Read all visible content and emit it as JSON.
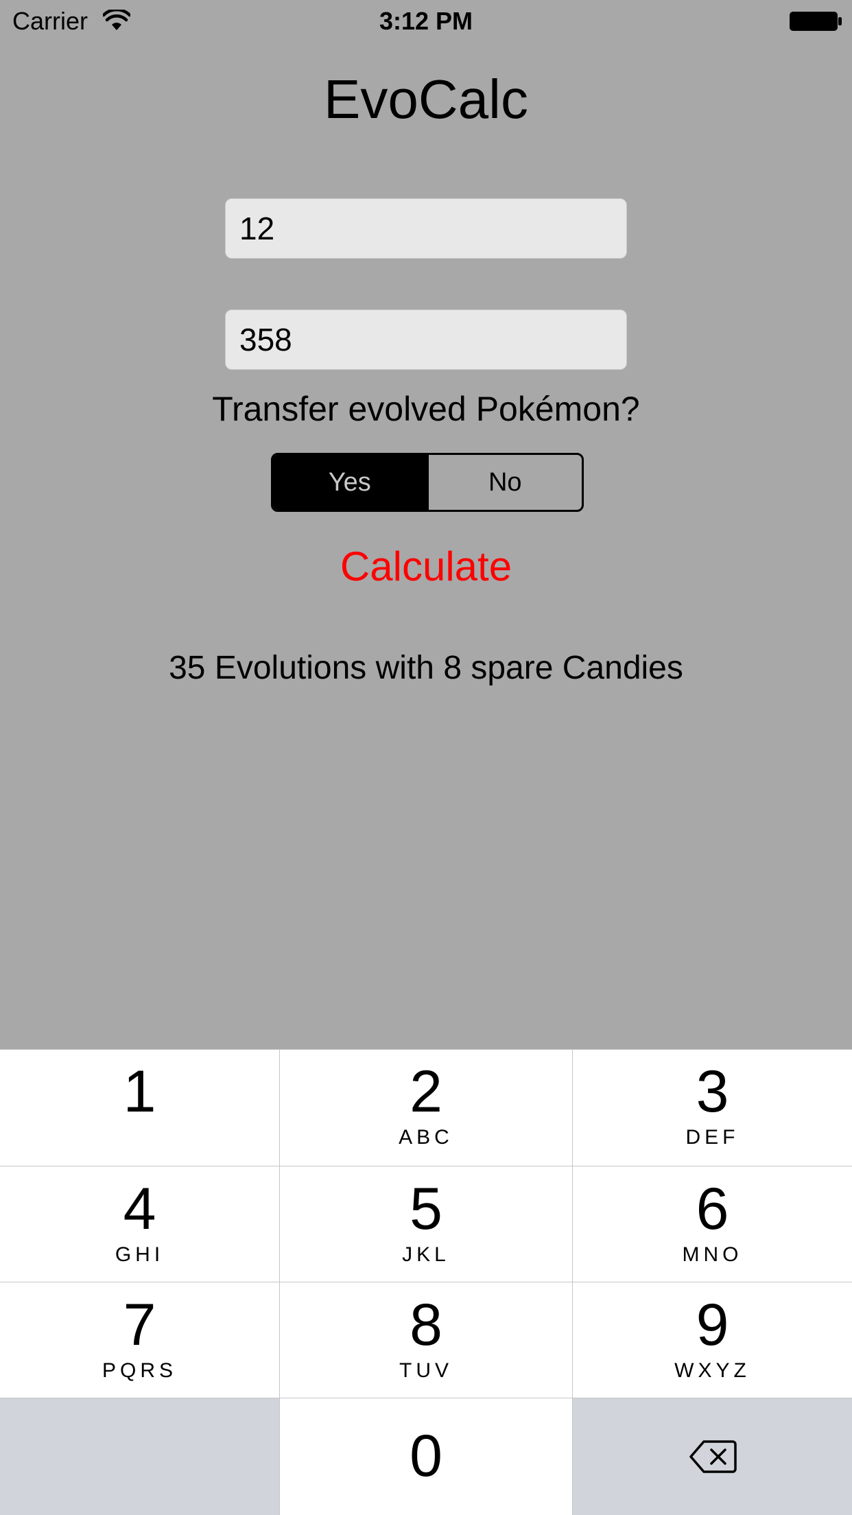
{
  "status_bar": {
    "carrier": "Carrier",
    "time": "3:12 PM",
    "wifi_icon": "wifi-icon",
    "battery_icon": "battery-icon"
  },
  "app": {
    "title": "EvoCalc",
    "field_1_value": "12",
    "field_2_value": "358",
    "question": "Transfer evolved Pokémon?",
    "segmented": {
      "options": [
        "Yes",
        "No"
      ],
      "selected": "Yes"
    },
    "calculate_label": "Calculate",
    "calculate_color": "#ff0000",
    "result": "35 Evolutions with 8 spare Candies",
    "background_color": "#a8a8a8"
  },
  "keypad": {
    "keys": [
      {
        "digit": "1",
        "letters": ""
      },
      {
        "digit": "2",
        "letters": "ABC"
      },
      {
        "digit": "3",
        "letters": "DEF"
      },
      {
        "digit": "4",
        "letters": "GHI"
      },
      {
        "digit": "5",
        "letters": "JKL"
      },
      {
        "digit": "6",
        "letters": "MNO"
      },
      {
        "digit": "7",
        "letters": "PQRS"
      },
      {
        "digit": "8",
        "letters": "TUV"
      },
      {
        "digit": "9",
        "letters": "WXYZ"
      },
      {
        "digit": "0",
        "letters": ""
      }
    ],
    "backspace_icon": "backspace-icon"
  }
}
